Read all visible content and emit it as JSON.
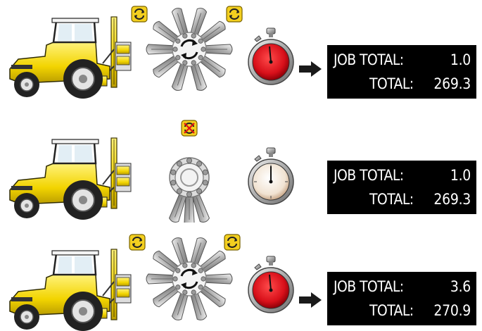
{
  "rows": [
    {
      "state": "rotating",
      "job_total_label": "JOB TOTAL:",
      "job_total_value": "1.0",
      "total_label": "TOTAL:",
      "total_value": "269.3",
      "timer": "running",
      "arrow": true
    },
    {
      "state": "stopped",
      "job_total_label": "JOB TOTAL:",
      "job_total_value": "1.0",
      "total_label": "TOTAL:",
      "total_value": "269.3",
      "timer": "stopped",
      "arrow": false
    },
    {
      "state": "rotating",
      "job_total_label": "JOB TOTAL:",
      "job_total_value": "3.6",
      "total_label": "TOTAL:",
      "total_value": "270.9",
      "timer": "running",
      "arrow": true
    }
  ],
  "icons": {
    "tractor": "tractor-icon",
    "rotor_running": "rotor-running-icon",
    "rotor_stopped": "rotor-stopped-icon",
    "rotation_on": "rotation-on-icon",
    "rotation_off": "rotation-off-icon",
    "stopwatch_running": "stopwatch-running-icon",
    "stopwatch_stopped": "stopwatch-stopped-icon",
    "arrow": "arrow-right-icon"
  },
  "colors": {
    "tractor_yellow": "#f2d400",
    "badge_yellow": "#f3cf1f",
    "timer_red": "#d8101a",
    "panel_bg": "#000000",
    "panel_text": "#ffffff"
  }
}
